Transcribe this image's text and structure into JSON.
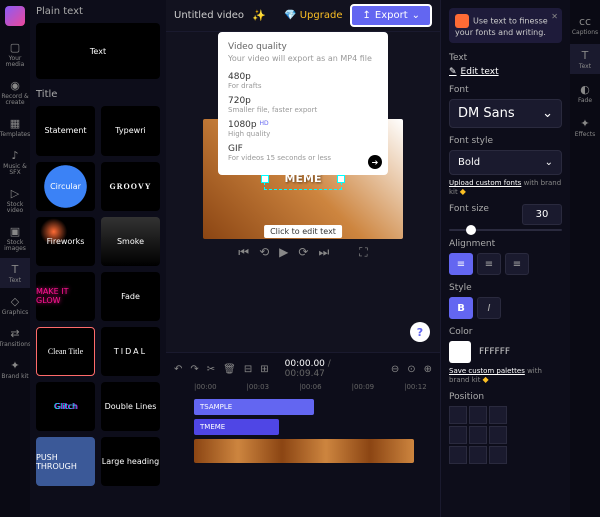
{
  "header": {
    "title": "Untitled video",
    "upgrade": "Upgrade",
    "export": "Export"
  },
  "leftRail": {
    "items": [
      {
        "label": "Your media"
      },
      {
        "label": "Record & create"
      },
      {
        "label": "Templates"
      },
      {
        "label": "Music & SFX"
      },
      {
        "label": "Stock video"
      },
      {
        "label": "Stock images"
      },
      {
        "label": "Text"
      },
      {
        "label": "Graphics"
      },
      {
        "label": "Transitions"
      },
      {
        "label": "Brand kit"
      }
    ]
  },
  "sidebar": {
    "section1": "Plain text",
    "section2": "Title",
    "thumbs": {
      "text": "Text",
      "statement": "Statement",
      "typewriter": "Typewri",
      "circular": "Circular",
      "groovy": "GROOVY",
      "fireworks": "Fireworks",
      "smoke": "Smoke",
      "glow": "MAKE IT GLOW",
      "fade": "Fade",
      "clean": "Clean Title",
      "tidal": "TIDAL",
      "glitch": "Glitch",
      "double": "Double Lines",
      "push": "PUSH THROUGH",
      "large": "Large heading"
    }
  },
  "exportPanel": {
    "title": "Video quality",
    "subtitle": "Your video will export as an MP4 file",
    "opts": [
      {
        "t": "480p",
        "s": "For drafts"
      },
      {
        "t": "720p",
        "s": "Smaller file, faster export"
      },
      {
        "t": "1080p",
        "s": "High quality",
        "hd": "HD"
      },
      {
        "t": "GIF",
        "s": "For videos 15 seconds or less"
      }
    ]
  },
  "canvas": {
    "text": "MEME",
    "tip": "Click to edit text"
  },
  "timeline": {
    "current": "00:00.00",
    "total": "00:09.47",
    "marks": [
      "|00:00",
      "|00:03",
      "|00:06",
      "|00:09",
      "|00:12"
    ],
    "clips": {
      "sample": "SAMPLE",
      "meme": "MEME"
    }
  },
  "rightPanel": {
    "tip": "Use text to finesse your fonts and writing.",
    "textLabel": "Text",
    "editText": "Edit text",
    "fontLabel": "Font",
    "fontValue": "DM Sans",
    "fontStyleLabel": "Font style",
    "fontStyleValue": "Bold",
    "uploadFonts": "Upload custom fonts",
    "withBrand": " with brand kit",
    "fontSizeLabel": "Font size",
    "fontSizeValue": "30",
    "alignLabel": "Alignment",
    "styleLabel": "Style",
    "colorLabel": "Color",
    "colorValue": "FFFFFF",
    "savePalettes": "Save custom palettes",
    "positionLabel": "Position"
  },
  "rightRail": {
    "items": [
      {
        "label": "Captions"
      },
      {
        "label": "Text"
      },
      {
        "label": "Fade"
      },
      {
        "label": "Effects"
      }
    ]
  }
}
